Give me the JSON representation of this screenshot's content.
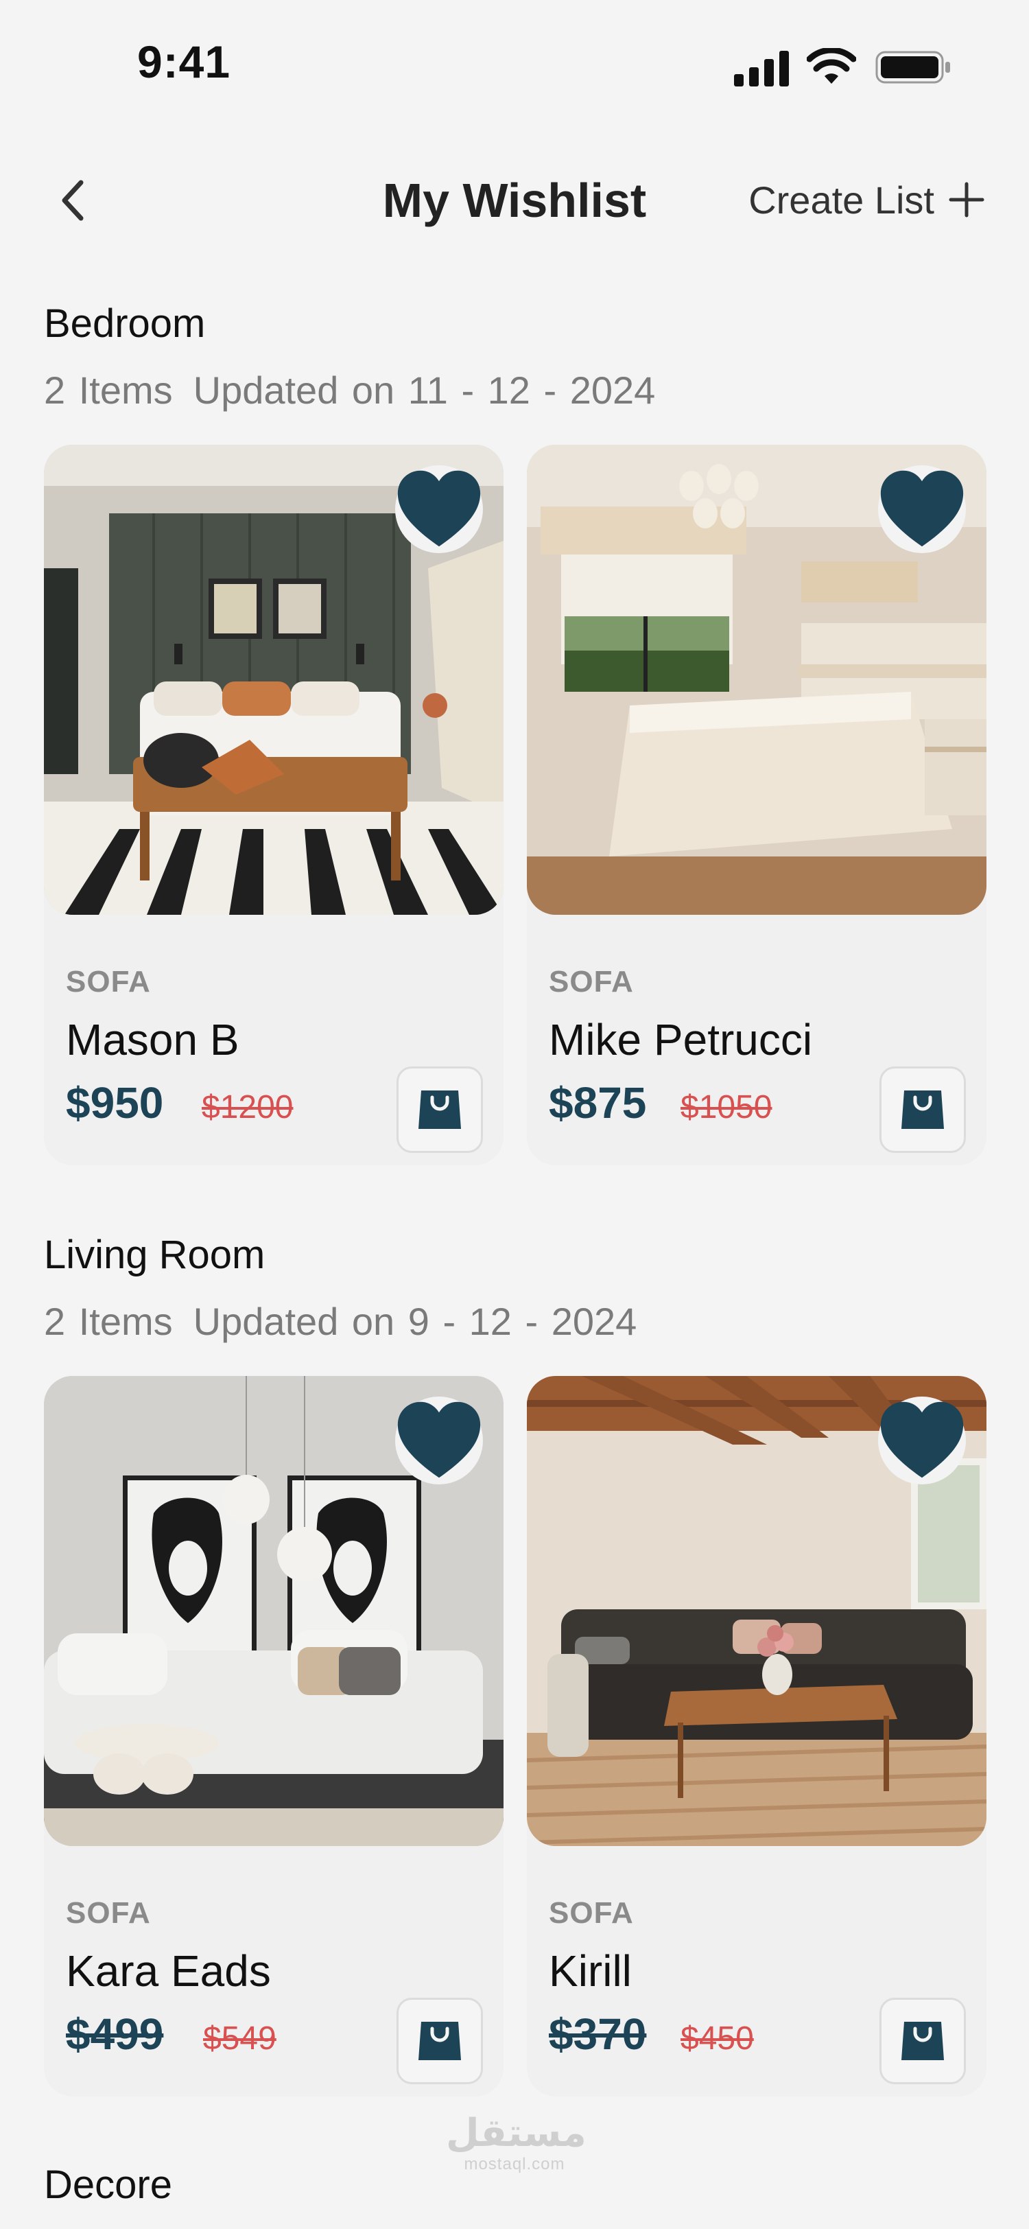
{
  "status_bar": {
    "time": "9:41"
  },
  "header": {
    "title": "My Wishlist",
    "create_list_label": "Create List"
  },
  "sections": [
    {
      "title": "Bedroom",
      "items_count": "2 Items",
      "updated": "Updated on 11 - 12 - 2024",
      "products": [
        {
          "category": "SOFA",
          "name": "Mason B",
          "price": "$950",
          "old_price": "$1200"
        },
        {
          "category": "SOFA",
          "name": "Mike Petrucci",
          "price": "$875",
          "old_price": "$1050"
        }
      ]
    },
    {
      "title": "Living Room",
      "items_count": "2 Items",
      "updated": "Updated on 9 - 12 - 2024",
      "products": [
        {
          "category": "SOFA",
          "name": "Kara Eads",
          "price": "$499",
          "old_price": "$549"
        },
        {
          "category": "SOFA",
          "name": "Kirill",
          "price": "$370",
          "old_price": "$450"
        }
      ]
    },
    {
      "title": "Decore"
    }
  ],
  "watermark": {
    "arabic": "مستقل",
    "latin": "mostaql.com"
  },
  "colors": {
    "accent": "#1d4356",
    "sale": "#d85050",
    "muted": "#7a7a7a"
  }
}
